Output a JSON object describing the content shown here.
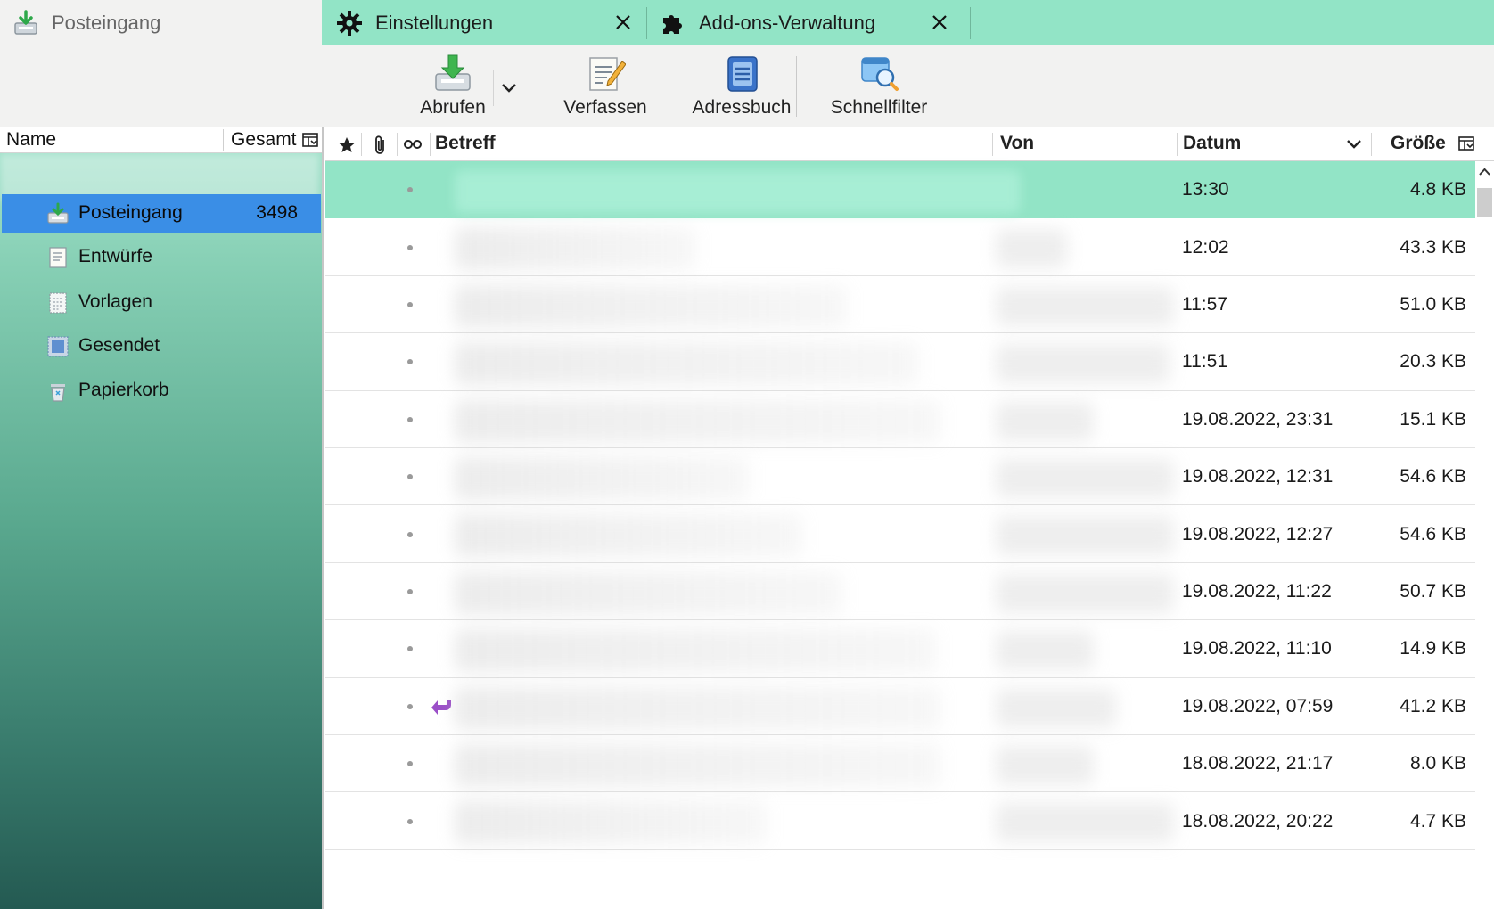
{
  "tabs": [
    {
      "label": "Posteingang",
      "icon": "inbox-download-icon",
      "active": true
    },
    {
      "label": "Einstellungen",
      "icon": "gear-icon",
      "closable": true
    },
    {
      "label": "Add-ons-Verwaltung",
      "icon": "puzzle-icon",
      "closable": true
    }
  ],
  "toolbar": {
    "get_messages": "Abrufen",
    "compose": "Verfassen",
    "address_book": "Adressbuch",
    "quick_filter": "Schnellfilter"
  },
  "folder_pane": {
    "header_name": "Name",
    "header_total": "Gesamt",
    "folders": [
      {
        "label": "Posteingang",
        "count": "3498",
        "icon": "inbox-icon",
        "selected": true
      },
      {
        "label": "Entwürfe",
        "count": "",
        "icon": "drafts-icon"
      },
      {
        "label": "Vorlagen",
        "count": "",
        "icon": "templates-icon"
      },
      {
        "label": "Gesendet",
        "count": "",
        "icon": "sent-icon"
      },
      {
        "label": "Papierkorb",
        "count": "",
        "icon": "trash-icon"
      }
    ]
  },
  "message_list": {
    "columns": {
      "subject": "Betreff",
      "from": "Von",
      "date": "Datum",
      "size": "Größe"
    },
    "rows": [
      {
        "date": "13:30",
        "size": "4.8 KB",
        "selected": true,
        "replied": false
      },
      {
        "date": "12:02",
        "size": "43.3 KB",
        "replied": false
      },
      {
        "date": "11:57",
        "size": "51.0 KB",
        "replied": false
      },
      {
        "date": "11:51",
        "size": "20.3 KB",
        "replied": false
      },
      {
        "date": "19.08.2022, 23:31",
        "size": "15.1 KB",
        "replied": false
      },
      {
        "date": "19.08.2022, 12:31",
        "size": "54.6 KB",
        "replied": false
      },
      {
        "date": "19.08.2022, 12:27",
        "size": "54.6 KB",
        "replied": false
      },
      {
        "date": "19.08.2022, 11:22",
        "size": "50.7 KB",
        "replied": false
      },
      {
        "date": "19.08.2022, 11:10",
        "size": "14.9 KB",
        "replied": false
      },
      {
        "date": "19.08.2022, 07:59",
        "size": "41.2 KB",
        "replied": true
      },
      {
        "date": "18.08.2022, 21:17",
        "size": "8.0 KB",
        "replied": false
      },
      {
        "date": "18.08.2022, 20:22",
        "size": "4.7 KB",
        "replied": false
      }
    ]
  },
  "colors": {
    "accent": "#92e4c6",
    "selected_folder": "#3a8ee6",
    "reply_arrow": "#9b4fc8"
  }
}
